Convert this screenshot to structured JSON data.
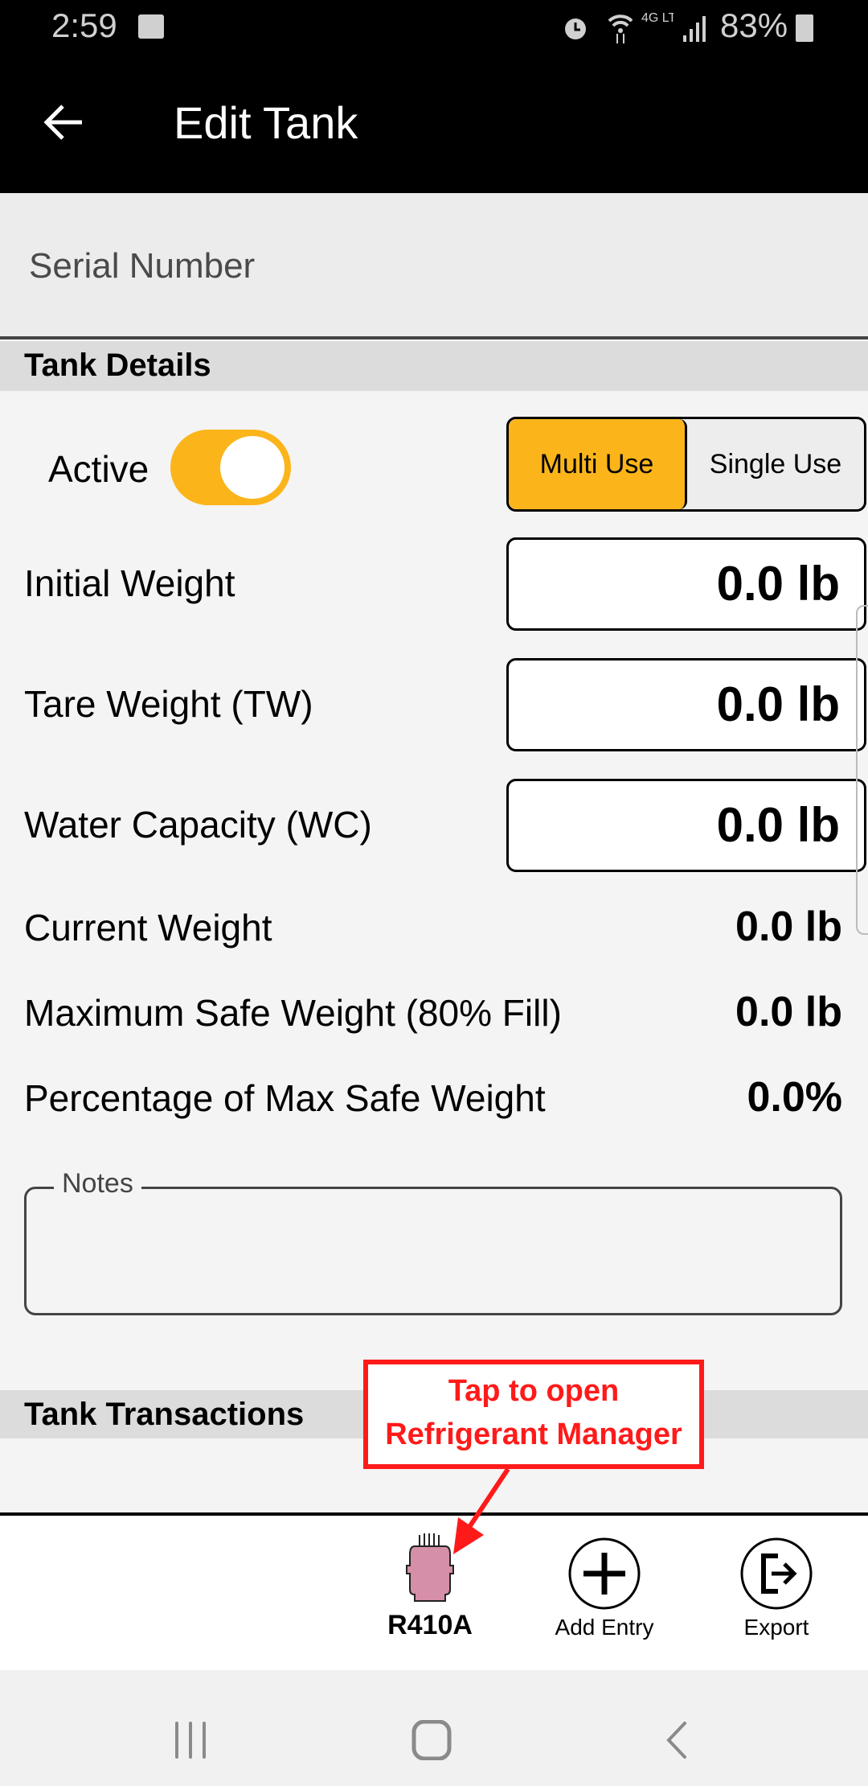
{
  "status_bar": {
    "time": "2:59",
    "battery": "83%",
    "network": "4G LTE",
    "icons": [
      "image-icon",
      "alarm-icon",
      "wifi-icon",
      "signal-icon",
      "battery-icon"
    ]
  },
  "header": {
    "title": "Edit Tank",
    "back_icon": "arrow-left-icon"
  },
  "serial": {
    "placeholder": "Serial Number",
    "value": ""
  },
  "tank_details": {
    "title": "Tank Details",
    "active_label": "Active",
    "active": true,
    "use_type": {
      "options": [
        "Multi Use",
        "Single Use"
      ],
      "selected": "Multi Use"
    },
    "inputs": [
      {
        "label": "Initial Weight",
        "value": "0.0 lb"
      },
      {
        "label": "Tare Weight (TW)",
        "value": "0.0 lb"
      },
      {
        "label": "Water Capacity (WC)",
        "value": "0.0 lb"
      }
    ],
    "readouts": [
      {
        "label": "Current Weight",
        "value": "0.0 lb"
      },
      {
        "label": "Maximum Safe Weight (80% Fill)",
        "value": "0.0 lb"
      },
      {
        "label": "Percentage of Max Safe Weight",
        "value": "0.0%"
      }
    ],
    "notes_label": "Notes",
    "notes_value": ""
  },
  "transactions": {
    "title": "Tank Transactions"
  },
  "callout": {
    "line1": "Tap to open",
    "line2": "Refrigerant Manager"
  },
  "footer": {
    "refrigerant": "R410A",
    "add_entry": "Add Entry",
    "export": "Export"
  },
  "colors": {
    "accent": "#fbb51b",
    "callout": "#ff1a1a",
    "tank": "#d68fa8"
  }
}
